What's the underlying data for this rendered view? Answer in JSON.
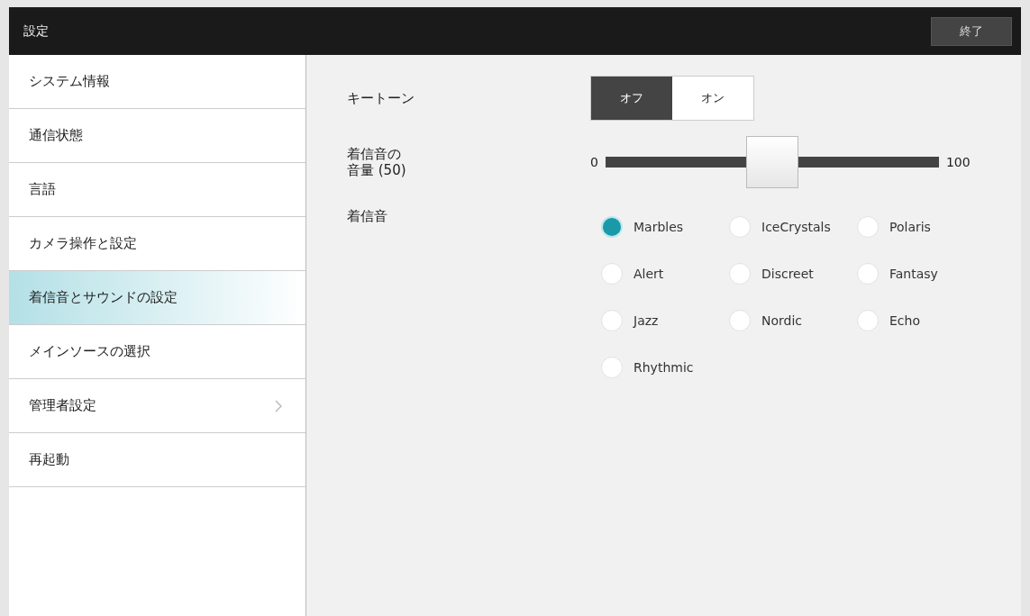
{
  "header": {
    "title": "設定",
    "exit_button": "終了"
  },
  "sidebar": {
    "items": [
      {
        "label": "システム情報",
        "selected": false,
        "has_submenu": false
      },
      {
        "label": "通信状態",
        "selected": false,
        "has_submenu": false
      },
      {
        "label": "言語",
        "selected": false,
        "has_submenu": false
      },
      {
        "label": "カメラ操作と設定",
        "selected": false,
        "has_submenu": false
      },
      {
        "label": "着信音とサウンドの設定",
        "selected": true,
        "has_submenu": false
      },
      {
        "label": "メインソースの選択",
        "selected": false,
        "has_submenu": false
      },
      {
        "label": "管理者設定",
        "selected": false,
        "has_submenu": true
      },
      {
        "label": "再起動",
        "selected": false,
        "has_submenu": false
      }
    ]
  },
  "key_tone": {
    "label": "キートーン",
    "options": [
      {
        "label": "オフ",
        "selected": true
      },
      {
        "label": "オン",
        "selected": false
      }
    ]
  },
  "ringtone_volume": {
    "label_line_1": "着信音の",
    "label_line_2": "音量 (50)",
    "min": "0",
    "max": "100",
    "level": 0.5
  },
  "ringtone": {
    "label": "着信音",
    "options": [
      {
        "label": "Marbles",
        "selected": true
      },
      {
        "label": "IceCrystals",
        "selected": false
      },
      {
        "label": "Polaris",
        "selected": false
      },
      {
        "label": "Alert",
        "selected": false
      },
      {
        "label": "Discreet",
        "selected": false
      },
      {
        "label": "Fantasy",
        "selected": false
      },
      {
        "label": "Jazz",
        "selected": false
      },
      {
        "label": "Nordic",
        "selected": false
      },
      {
        "label": "Echo",
        "selected": false
      },
      {
        "label": "Rhythmic",
        "selected": false
      }
    ]
  }
}
